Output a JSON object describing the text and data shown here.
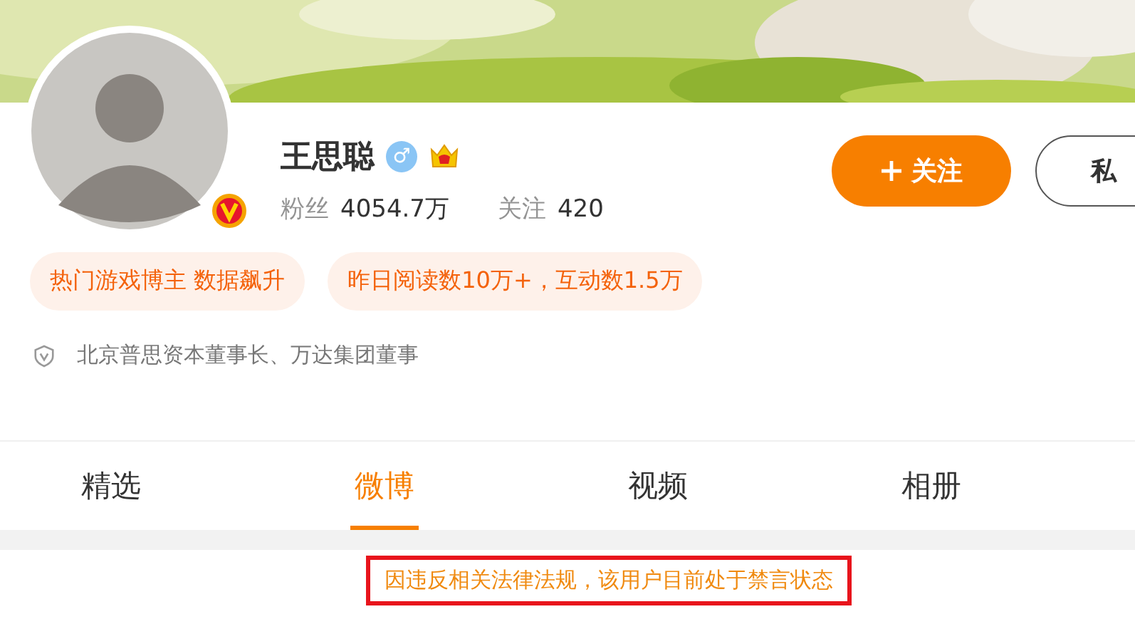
{
  "profile": {
    "name": "王思聪",
    "gender_symbol": "♂",
    "crown": true,
    "verified": true,
    "stats": [
      {
        "label": "粉丝",
        "value": "4054.7万"
      },
      {
        "label": "关注",
        "value": "420"
      }
    ]
  },
  "buttons": [
    {
      "label": "关注",
      "kind": "primary"
    },
    {
      "label": "私",
      "kind": "secondary"
    }
  ],
  "tags": [
    "热门游戏博主 数据飙升",
    "昨日阅读数10万+，互动数1.5万"
  ],
  "bio": "北京普思资本董事长、万达集团董事",
  "tabs": [
    {
      "label": "精选",
      "selected": false
    },
    {
      "label": "微博",
      "selected": true
    },
    {
      "label": "视频",
      "selected": false
    },
    {
      "label": "相册",
      "selected": false
    }
  ],
  "notice": "因违反相关法律法规，该用户目前处于禁言状态"
}
